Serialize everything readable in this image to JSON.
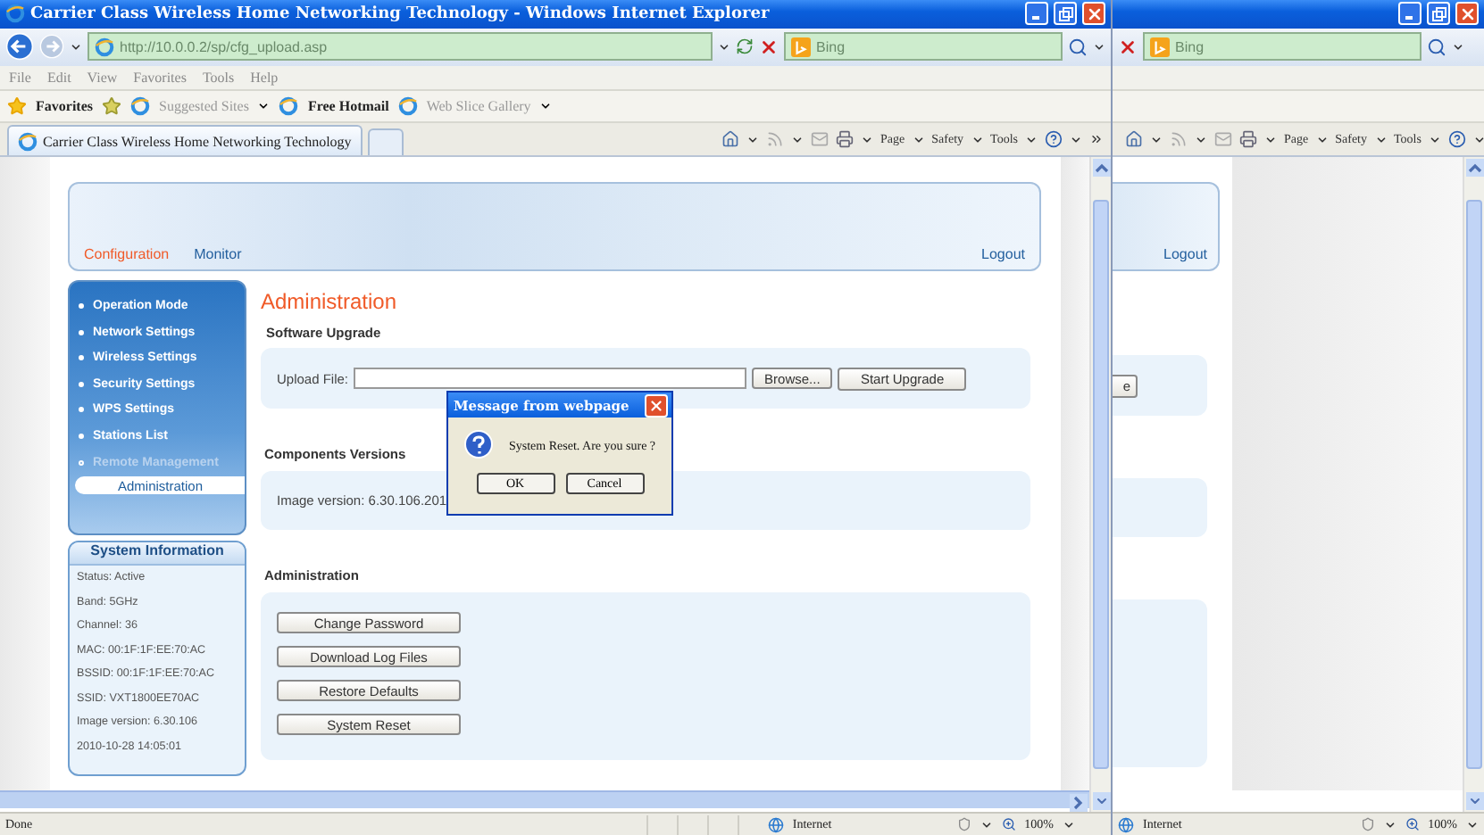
{
  "main_window": {
    "title": "Carrier Class Wireless Home Networking Technology - Windows Internet Explorer",
    "address": "http://10.0.0.2/sp/cfg_upload.asp",
    "search": {
      "placeholder": "Bing"
    },
    "menu": [
      "File",
      "Edit",
      "View",
      "Favorites",
      "Tools",
      "Help"
    ],
    "favorites": {
      "label": "Favorites",
      "links": [
        {
          "label": "Suggested Sites",
          "dropdown": true
        },
        {
          "label": "Free Hotmail",
          "dropdown": false
        },
        {
          "label": "Web Slice Gallery",
          "dropdown": true
        }
      ]
    },
    "tabs": [
      {
        "label": "Carrier Class Wireless Home Networking Technology",
        "selected": true
      }
    ],
    "commands": [
      "Page",
      "Safety",
      "Tools"
    ],
    "status": {
      "text": "Done",
      "zone": "Internet",
      "zoom": "100%"
    }
  },
  "page": {
    "nav_tabs": [
      {
        "label": "Configuration",
        "selected": true
      },
      {
        "label": "Monitor",
        "selected": false
      }
    ],
    "logout": "Logout",
    "sidebar": [
      {
        "label": "Operation Mode",
        "expanded": false
      },
      {
        "label": "Network Settings",
        "expanded": false
      },
      {
        "label": "Wireless Settings",
        "expanded": false
      },
      {
        "label": "Security Settings",
        "expanded": false
      },
      {
        "label": "WPS Settings",
        "expanded": false
      },
      {
        "label": "Stations List",
        "expanded": false
      },
      {
        "label": "Remote Management",
        "expanded": true,
        "children": [
          {
            "label": "Administration",
            "selected": true
          }
        ]
      }
    ],
    "system_info": {
      "title": "System Information",
      "lines": [
        "Status: Active",
        "Band: 5GHz",
        "Channel: 36",
        "MAC: 00:1F:1F:EE:70:AC",
        "BSSID: 00:1F:1F:EE:70:AC",
        "SSID: VXT1800EE70AC",
        "Image version: 6.30.106",
        "2010-10-28 14:05:01"
      ]
    },
    "heading": "Administration",
    "upgrade": {
      "title": "Software Upgrade",
      "label": "Upload File:",
      "browse": "Browse...",
      "button": "Start Upgrade"
    },
    "versions": {
      "title": "Components Versions",
      "text": "Image version: 6.30.106.201"
    },
    "admin": {
      "title": "Administration",
      "buttons": [
        "Change Password",
        "Download Log Files",
        "Restore Defaults",
        "System Reset"
      ]
    }
  },
  "dialog": {
    "title": "Message from webpage",
    "message": "System Reset. Are you sure ?",
    "buttons": [
      "OK",
      "Cancel"
    ]
  },
  "back_window": {
    "search": {
      "placeholder": "Bing"
    },
    "commands": [
      "Page",
      "Safety",
      "Tools"
    ],
    "logout": "Logout",
    "button_fragment": "e",
    "status": {
      "zone": "Internet",
      "zoom": "100%"
    }
  }
}
